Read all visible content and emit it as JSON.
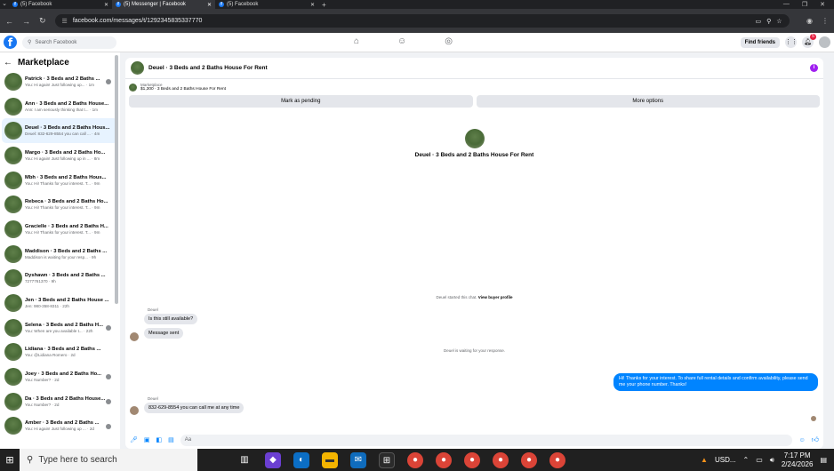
{
  "browser": {
    "tabs": [
      {
        "title": "(5) Facebook",
        "active": false
      },
      {
        "title": "(5) Messenger | Facebook",
        "active": true
      },
      {
        "title": "(5) Facebook",
        "active": false
      }
    ],
    "url": "facebook.com/messages/t/1292345835337770"
  },
  "header": {
    "search_placeholder": "Search Facebook",
    "find_friends": "Find friends",
    "notification_count": "5"
  },
  "sidebar": {
    "title": "Marketplace",
    "conversations": [
      {
        "name": "Patrick · 3 Beds and 2 Baths ...",
        "preview": "You: Hi again! Just following up... · 1m",
        "selected": false,
        "dot": true
      },
      {
        "name": "Ann · 3 Beds and 2 Baths House...",
        "preview": "Ann: I am seriously thinking that t... · 1m",
        "selected": false,
        "dot": false
      },
      {
        "name": "Deuel · 3 Beds and 2 Baths Hous...",
        "preview": "Deuel: 832-629-8554 you can call ... · 4m",
        "selected": true,
        "dot": false
      },
      {
        "name": "Margo · 3 Beds and 2 Baths Ho...",
        "preview": "You: Hi again! Just following up in ... · 8m",
        "selected": false,
        "dot": false
      },
      {
        "name": "Mbh · 3 Beds and 2 Baths Hous...",
        "preview": "You: Hi! Thanks for your interest. T... · 9m",
        "selected": false,
        "dot": false
      },
      {
        "name": "Rebeca · 3 Beds and 2 Baths Ho...",
        "preview": "You: Hi! Thanks for your interest. T... · 9m",
        "selected": false,
        "dot": false
      },
      {
        "name": "Gracielle · 3 Beds and 2 Baths H...",
        "preview": "You: Hi! Thanks for your interest. T... · 9m",
        "selected": false,
        "dot": false
      },
      {
        "name": "Maddison · 3 Beds and 2 Baths ...",
        "preview": "Maddison is waiting for your resp... · 9h",
        "selected": false,
        "dot": false
      },
      {
        "name": "Dyshawn · 3 Beds and 2 Baths ...",
        "preview": "7277761370 · 9h",
        "selected": false,
        "dot": false
      },
      {
        "name": "Jen · 3 Beds and 2 Baths House ...",
        "preview": "Jen: 980-358-8311 · 22h",
        "selected": false,
        "dot": false
      },
      {
        "name": "Selena · 3 Beds and 2 Baths H...",
        "preview": "You: When are you available t... · 22h",
        "selected": false,
        "dot": true
      },
      {
        "name": "Lidiana · 3 Beds and 2 Baths ...",
        "preview": "You: @Lidiana Romero · 2d",
        "selected": false,
        "dot": false
      },
      {
        "name": "Joey · 3 Beds and 2 Baths Ho...",
        "preview": "You: Number? · 2d",
        "selected": false,
        "dot": true
      },
      {
        "name": "Da · 3 Beds and 2 Baths House...",
        "preview": "You: Number? · 2d",
        "selected": false,
        "dot": true
      },
      {
        "name": "Amber · 3 Beds and 2 Baths ...",
        "preview": "You: Hi again! Just following up ... · 2d",
        "selected": false,
        "dot": true
      }
    ]
  },
  "chat": {
    "title": "Deuel · 3 Beds and 2 Baths House For Rent",
    "marketplace_label": "Marketplace",
    "listing": "$1,300 · 3 Beds and 2 Baths House For Rent",
    "mark_pending": "Mark as pending",
    "more_options": "More options",
    "center_title": "Deuel · 3 Beds and 2 Baths House For Rent",
    "started_text": "Deuel started this chat.",
    "view_profile": "View buyer profile",
    "sender1": "Deuel",
    "msg1": "Is this still available?",
    "msg2": "Message sent",
    "waiting": "Deuel is waiting for your response.",
    "outgoing": "Hi! Thanks for your interest. To share full rental details and confirm availability, please send me your phone number. Thanks!",
    "sender2": "Deuel",
    "msg3": "832-629-8554 you can call me at any time",
    "composer_placeholder": "Aa"
  },
  "taskbar": {
    "search_placeholder": "Type here to search",
    "currency": "USD...",
    "time": "7:17 PM",
    "date": "2/24/2026"
  }
}
